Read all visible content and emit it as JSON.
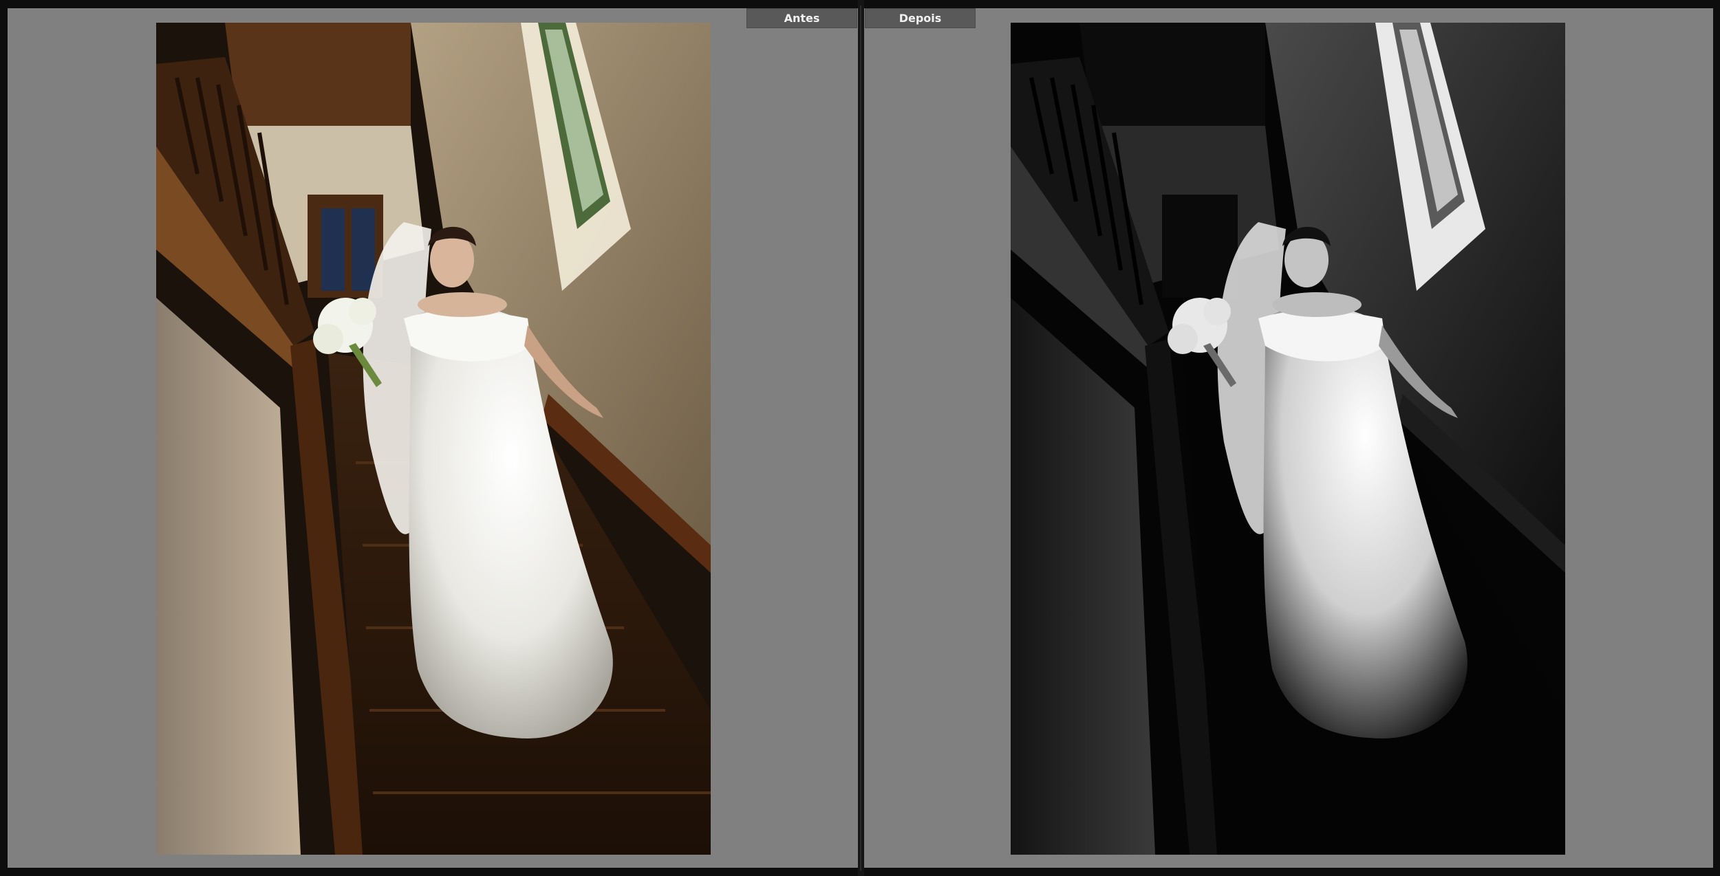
{
  "compare_view": {
    "before_label": "Antes",
    "after_label": "Depois"
  },
  "icons": {
    "before_photo": "photo-color-bride-staircase",
    "after_photo": "photo-bw-bride-staircase"
  }
}
